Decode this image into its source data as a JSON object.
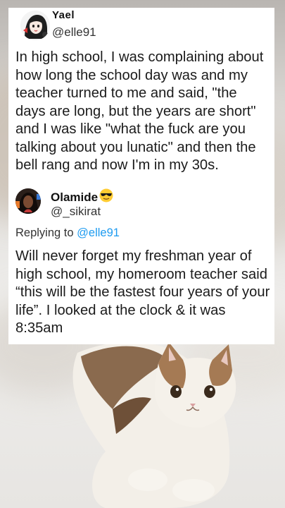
{
  "tweet1": {
    "name": "Yael",
    "handle": "@elle91",
    "text": "In high school, I was complaining about how long the school day was and my teacher turned to me and said, \"the days are long, but the years are short\" and I was like \"what the fuck are you talking about you lunatic\" and then the bell rang and now I'm in my 30s."
  },
  "tweet2": {
    "name": "Olamide",
    "handle": "@_sikirat",
    "replying_prefix": "Replying to ",
    "replying_to": "@elle91",
    "text": "Will never forget my freshman year of high school, my homeroom teacher said “this will be the fastest four years of your life”. I looked at the clock & it was 8:35am"
  },
  "icons": {
    "emoji": "sunglasses-emoji",
    "avatar1": "cartoon-avatar",
    "avatar2": "profile-photo-avatar"
  },
  "colors": {
    "link": "#1d9bf0",
    "card": "#ffffff",
    "text": "#1b1b1b"
  }
}
